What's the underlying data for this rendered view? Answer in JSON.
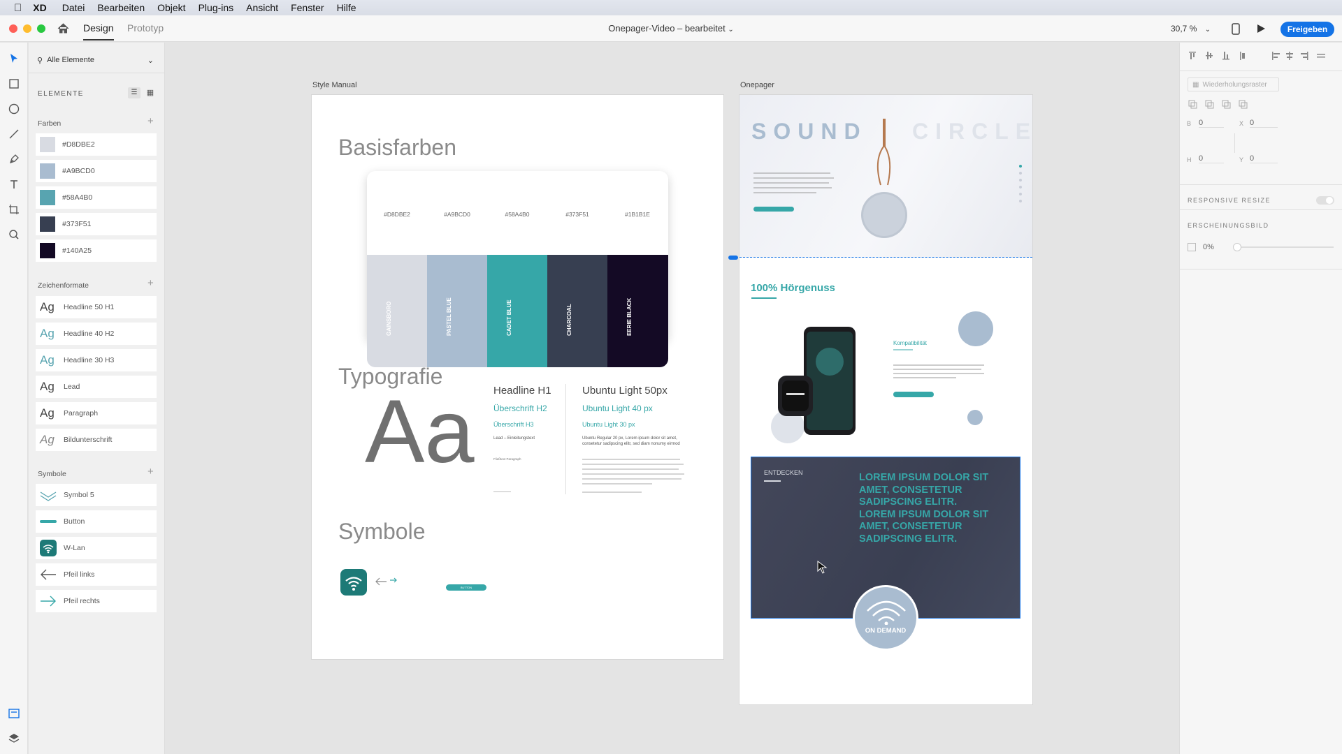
{
  "menubar": {
    "app": "XD",
    "items": [
      "Datei",
      "Bearbeiten",
      "Objekt",
      "Plug-ins",
      "Ansicht",
      "Fenster",
      "Hilfe"
    ]
  },
  "titlebar": {
    "tabs": [
      "Design",
      "Prototyp"
    ],
    "document_title": "Onepager-Video – bearbeitet",
    "zoom": "30,7 %",
    "share": "Freigeben"
  },
  "assets": {
    "filter": "Alle Elemente",
    "header": "ELEMENTE",
    "colors_title": "Farben",
    "colors": [
      {
        "hex": "#D8DBE2",
        "color": "#D8DBE2"
      },
      {
        "hex": "#A9BCD0",
        "color": "#A9BCD0"
      },
      {
        "hex": "#58A4B0",
        "color": "#58A4B0"
      },
      {
        "hex": "#373F51",
        "color": "#373F51"
      },
      {
        "hex": "#140A25",
        "color": "#140A25"
      }
    ],
    "charstyles_title": "Zeichenformate",
    "charstyles": [
      {
        "glyph": "Ag",
        "name": "Headline 50 H1",
        "color": "#444444"
      },
      {
        "glyph": "Ag",
        "name": "Headline 40 H2",
        "color": "#58A4B0"
      },
      {
        "glyph": "Ag",
        "name": "Headline 30 H3",
        "color": "#58A4B0"
      },
      {
        "glyph": "Ag",
        "name": "Lead",
        "color": "#444444"
      },
      {
        "glyph": "Ag",
        "name": "Paragraph",
        "color": "#444444"
      },
      {
        "glyph": "Ag",
        "name": "Bildunterschrift",
        "color": "#888888"
      }
    ],
    "symbols_title": "Symbole",
    "symbols": [
      {
        "icon": "chevron-icon",
        "name": "Symbol 5"
      },
      {
        "icon": "button-icon",
        "name": "Button"
      },
      {
        "icon": "wifi-icon",
        "name": "W-Lan"
      },
      {
        "icon": "arrow-left-icon",
        "name": "Pfeil links"
      },
      {
        "icon": "arrow-right-icon",
        "name": "Pfeil rechts"
      }
    ]
  },
  "style_manual": {
    "label": "Style Manual",
    "basisfarben": "Basisfarben",
    "swatches": [
      {
        "hex": "#D8DBE2",
        "name": "GAINSBORO",
        "color": "#D8DBE2",
        "text": "#ffffff"
      },
      {
        "hex": "#A9BCD0",
        "name": "PASTEL BLUE",
        "color": "#A9BCD0",
        "text": "#ffffff"
      },
      {
        "hex": "#58A4B0",
        "name": "CADET BLUE",
        "color": "#36A7A8",
        "text": "#ffffff"
      },
      {
        "hex": "#373F51",
        "name": "CHARCOAL",
        "color": "#373F51",
        "text": "#ffffff"
      },
      {
        "hex": "#1B1B1E",
        "name": "EERIE BLACK",
        "color": "#140A25",
        "text": "#ffffff"
      }
    ],
    "typografie": "Typografie",
    "big_aa": "Aa",
    "type_left": [
      "Headline H1",
      "Überschrift H2",
      "Überschrift H3",
      "Lead – Einleitungstext",
      "Fließtext Paragraph"
    ],
    "type_right": [
      "Ubuntu Light 50px",
      "Ubuntu Light 40 px",
      "Ubuntu Light 30 px",
      "Ubuntu Regular 20 px, Lorem ipsum dolor sit amet, consetetur sadipscing elitr, sed diam nonumy eirmod"
    ],
    "symbole": "Symbole",
    "button_label": "BUTTON"
  },
  "onepager": {
    "label": "Onepager",
    "hero_title_left": "SOUND",
    "hero_title_right": "CIRCLE",
    "section_title": "100% Hörgenuss",
    "compat": "Kompatibilität",
    "entdecken": "ENTDECKEN",
    "lorem_heading": "LOREM IPSUM DOLOR SIT AMET, CONSETETUR SADIPSCING ELITR. LOREM IPSUM DOLOR SIT AMET, CONSETETUR SADIPSCING ELITR.",
    "on_demand": "ON DEMAND"
  },
  "inspector": {
    "repeat_grid": "Wiederholungsraster",
    "w_label": "B",
    "w": "0",
    "x_label": "X",
    "x": "0",
    "h_label": "H",
    "h": "0",
    "y_label": "Y",
    "y": "0",
    "responsive": "RESPONSIVE RESIZE",
    "appearance": "ERSCHEINUNGSBILD",
    "opacity": "0%"
  }
}
